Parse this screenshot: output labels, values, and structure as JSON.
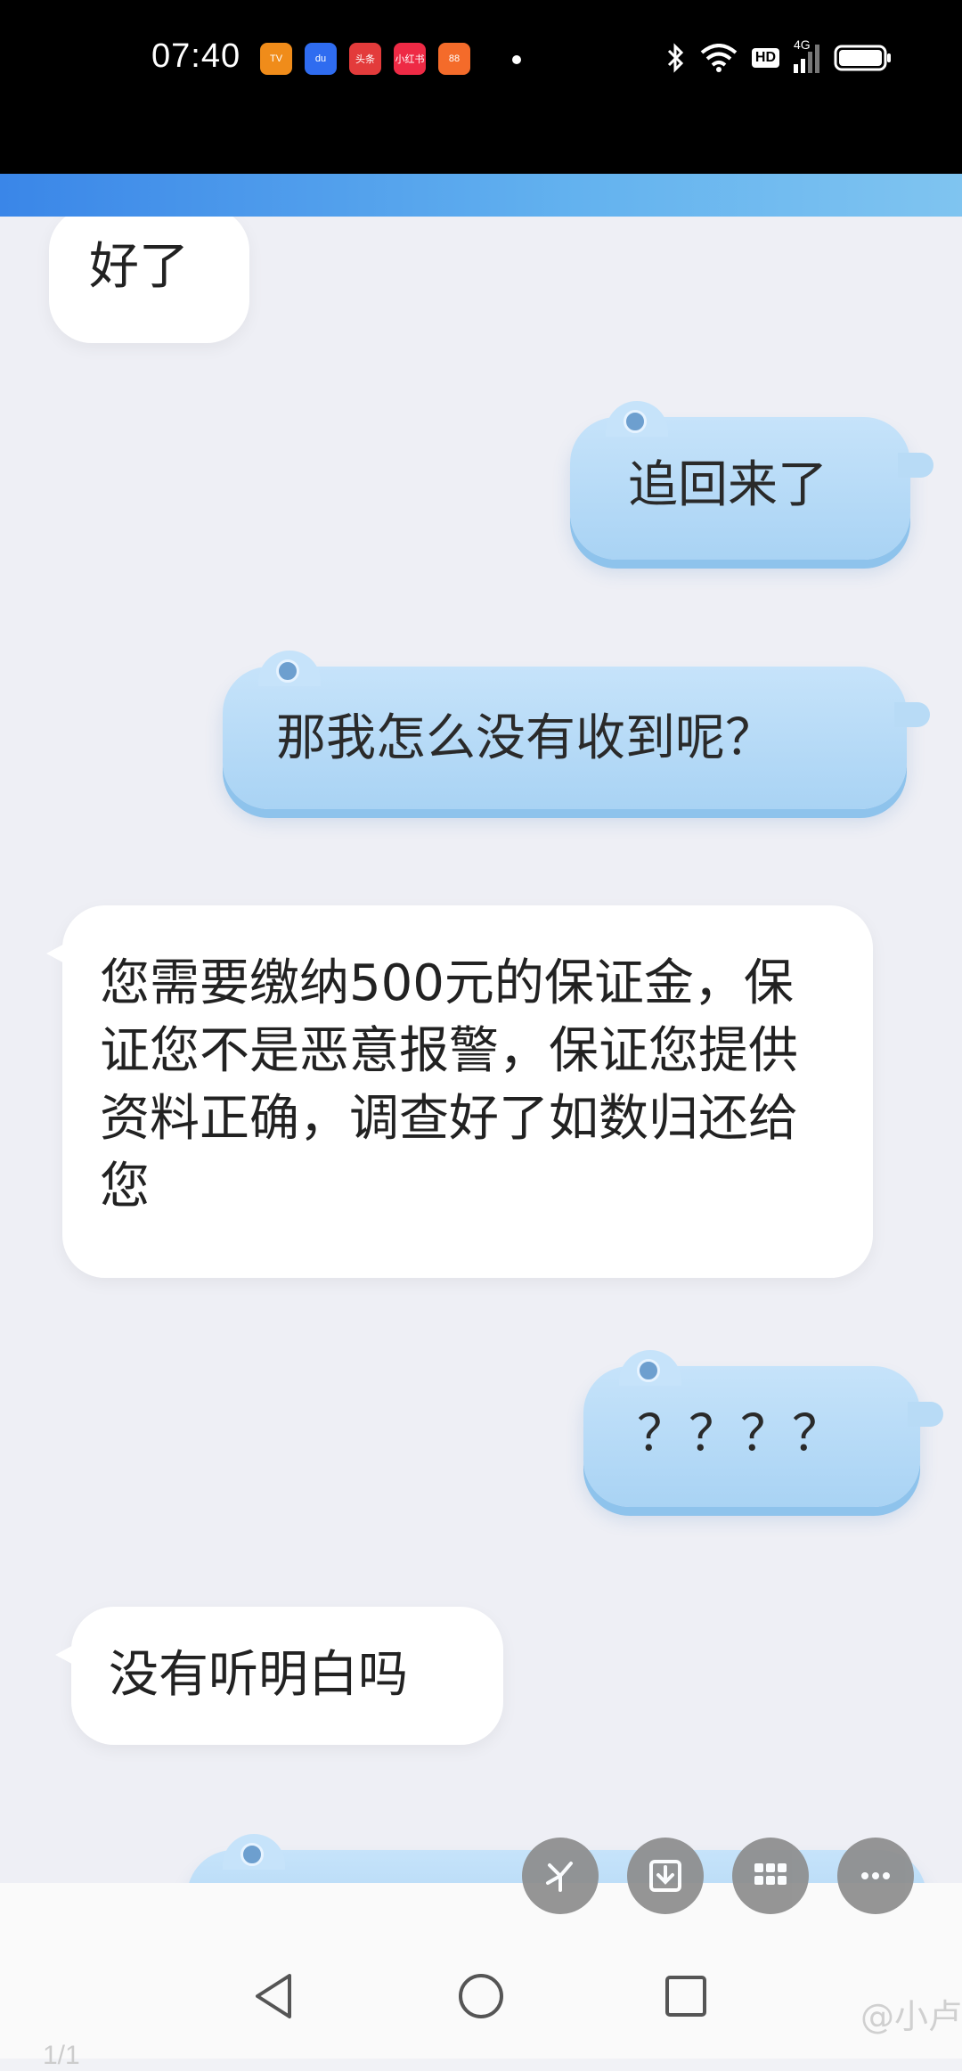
{
  "status_bar": {
    "time": "07:40",
    "apps": [
      {
        "name": "mango-tv-icon",
        "label": "TV",
        "color": "#f08c1a"
      },
      {
        "name": "baidu-icon",
        "label": "du",
        "color": "#2f6cf0"
      },
      {
        "name": "toutiao-icon",
        "label": "头条",
        "color": "#e33b3b"
      },
      {
        "name": "xiaohongshu-icon",
        "label": "小红书",
        "color": "#ee2a45"
      },
      {
        "name": "kuaishou-icon",
        "label": "88",
        "color": "#f46b2a"
      }
    ],
    "hd_label": "HD",
    "network_label": "4G"
  },
  "messages": [
    {
      "side": "left",
      "text": "好了"
    },
    {
      "side": "right",
      "text": "追回来了"
    },
    {
      "side": "right",
      "text": "那我怎么没有收到呢？"
    },
    {
      "side": "left",
      "text": "您需要缴纳500元的保证金，保证您不是恶意报警，保证您提供资料正确，调查好了如数归还给您"
    },
    {
      "side": "right",
      "text": "？？？？"
    },
    {
      "side": "left",
      "text": "没有听明白吗"
    }
  ],
  "fab": [
    "share-icon",
    "download-icon",
    "grid-icon",
    "more-icon"
  ],
  "page_indicator": "1/1",
  "watermark": "@小卢"
}
